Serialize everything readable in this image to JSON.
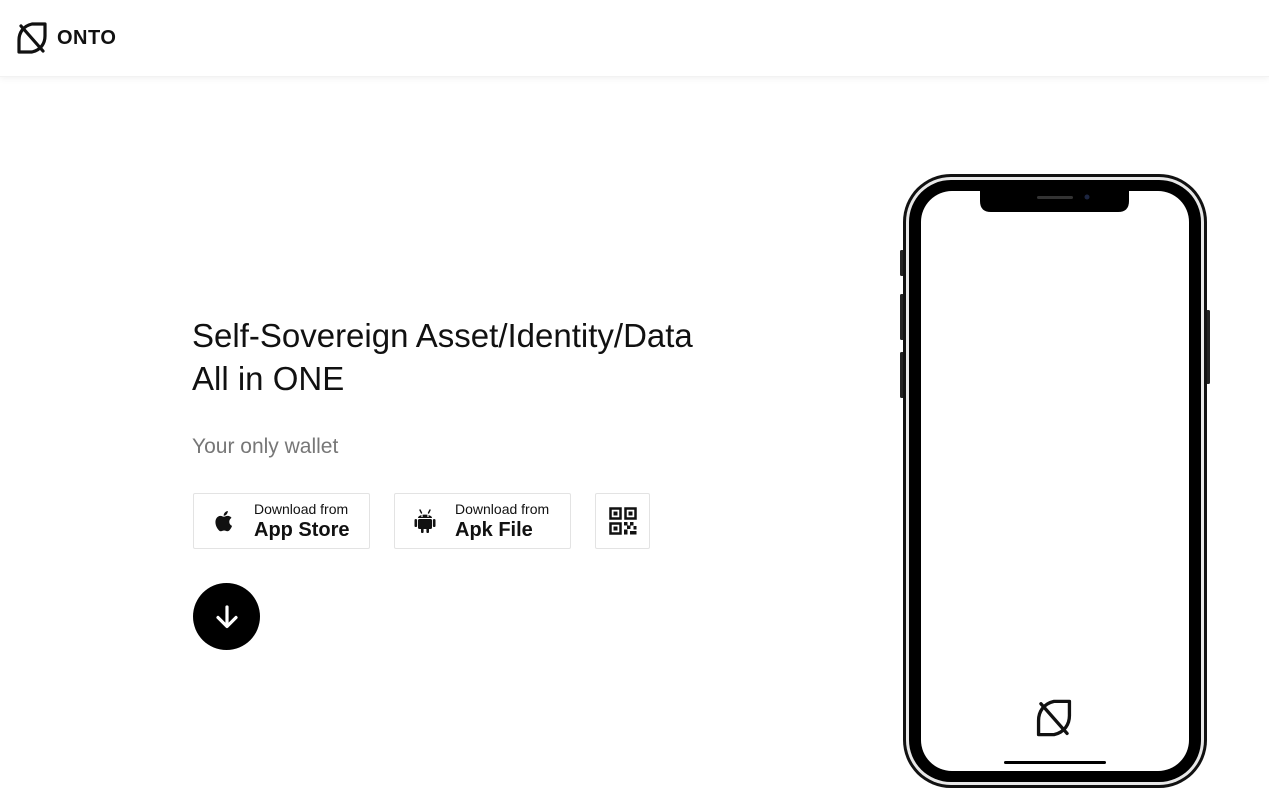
{
  "header": {
    "logo_text": "ONTO",
    "logo_icon": "onto-logo-icon"
  },
  "hero": {
    "title_line1": "Self-Sovereign Asset/Identity/Data",
    "title_line2": "All in ONE",
    "subtitle": "Your only wallet"
  },
  "downloads": {
    "app_store": {
      "small_label": "Download from",
      "big_label": "App Store",
      "icon": "apple-icon"
    },
    "apk": {
      "small_label": "Download from",
      "big_label": "Apk File",
      "icon": "android-icon"
    },
    "qr_icon": "qr-code-icon"
  },
  "scroll_down_icon": "arrow-down-icon",
  "phone_mockup": {
    "screen_icon": "onto-logo-icon"
  },
  "colors": {
    "text": "#111111",
    "subtitle": "#777777",
    "border": "#e3e3e3",
    "accent": "#000000"
  }
}
